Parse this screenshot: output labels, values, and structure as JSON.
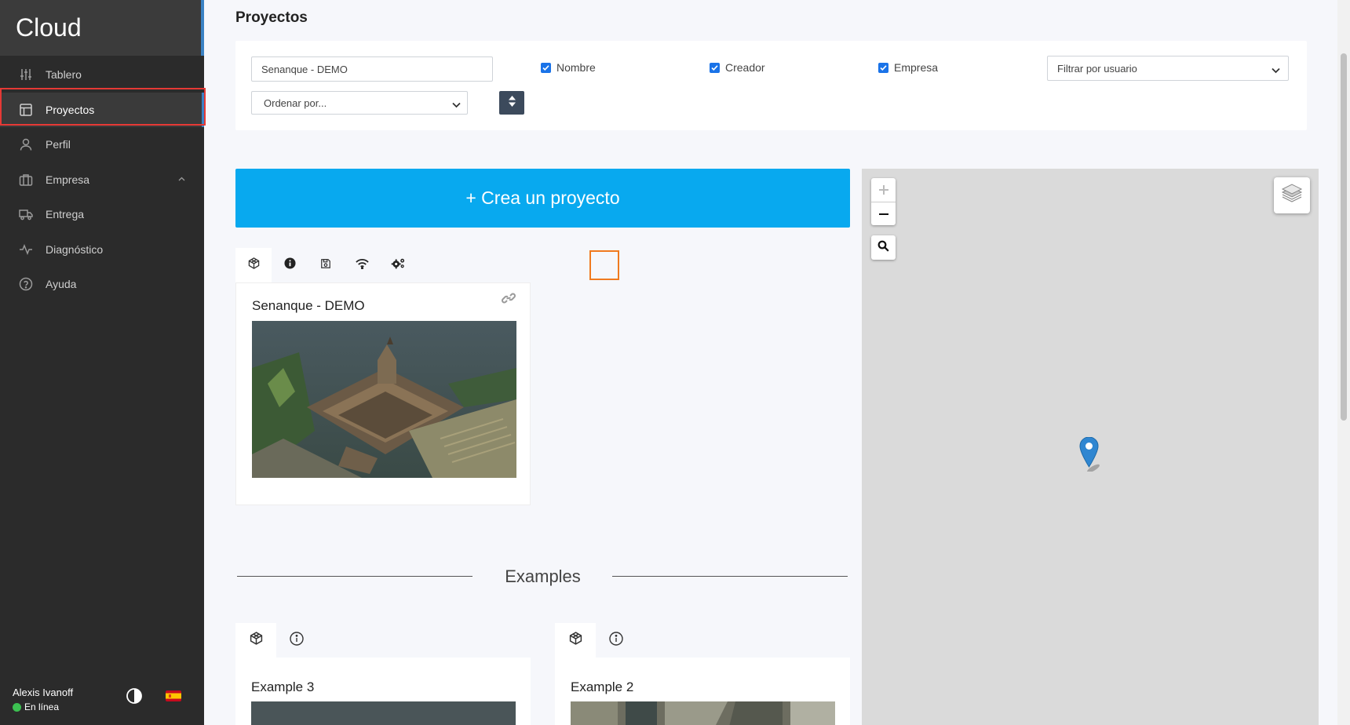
{
  "sidebar": {
    "brand": "Cloud",
    "items": [
      {
        "label": "Tablero"
      },
      {
        "label": "Proyectos"
      },
      {
        "label": "Perfil"
      },
      {
        "label": "Empresa"
      },
      {
        "label": "Entrega"
      },
      {
        "label": "Diagnóstico"
      },
      {
        "label": "Ayuda"
      }
    ],
    "user": {
      "name": "Alexis Ivanoff",
      "status": "En línea"
    }
  },
  "main": {
    "title": "Proyectos",
    "filters": {
      "search_value": "Senanque - DEMO",
      "check_nombre": "Nombre",
      "check_creador": "Creador",
      "check_empresa": "Empresa",
      "user_filter": "Filtrar por usuario",
      "sort": "Ordenar por..."
    },
    "create_button": "+ Crea un proyecto",
    "project": {
      "name": "Senanque - DEMO"
    },
    "examples_label": "Examples",
    "examples": [
      {
        "name": "Example 3"
      },
      {
        "name": "Example 2"
      }
    ]
  },
  "colors": {
    "accent": "#08a9ef",
    "sidebar_bg": "#2b2b2b",
    "highlight_red": "#e53935",
    "highlight_orange": "#f07a1f",
    "marker": "#2f86d1"
  }
}
